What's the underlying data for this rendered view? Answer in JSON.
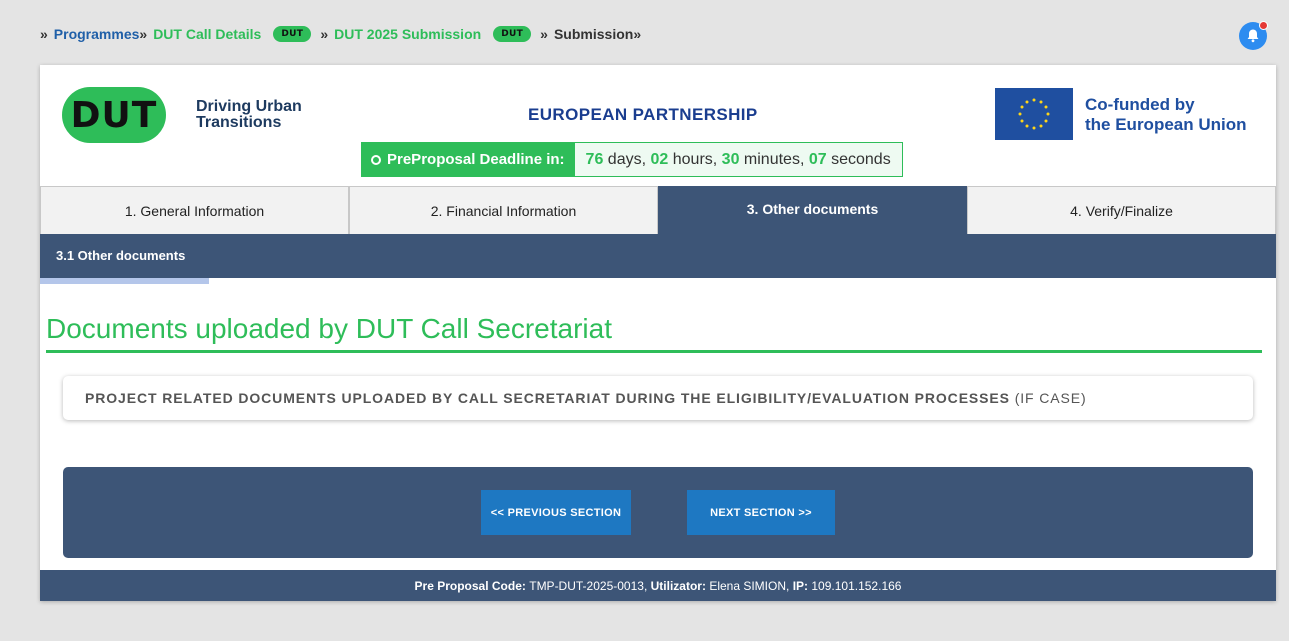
{
  "breadcrumb": {
    "prefix": "»",
    "programmes": "Programmes",
    "sep1": "»",
    "call_details": "DUT Call Details",
    "badge1": "DUT",
    "sep2": "»",
    "submission_2025": "DUT 2025 Submission",
    "badge2": "DUT",
    "sep3": "»",
    "current": "Submission»"
  },
  "header": {
    "logo_text": "DUT",
    "logo_caption_line1": "Driving Urban",
    "logo_caption_line2": "Transitions",
    "partnership": "EUROPEAN PARTNERSHIP",
    "eu_line1": "Co-funded by",
    "eu_line2": "the European Union"
  },
  "deadline": {
    "label": "PreProposal Deadline in:",
    "days": "76",
    "days_unit": "days,",
    "hours": "02",
    "hours_unit": "hours,",
    "minutes": "30",
    "minutes_unit": "minutes,",
    "seconds": "07",
    "seconds_unit": "seconds"
  },
  "tabs": [
    {
      "label": "1. General Information",
      "active": false
    },
    {
      "label": "2. Financial Information",
      "active": false
    },
    {
      "label": "3. Other documents",
      "active": true
    },
    {
      "label": "4. Verify/Finalize",
      "active": false
    }
  ],
  "subnav": {
    "item": "3.1 Other documents"
  },
  "section": {
    "title": "Documents uploaded by DUT Call Secretariat",
    "box_bold": "PROJECT RELATED DOCUMENTS UPLOADED BY CALL SECRETARIAT DURING THE ELIGIBILITY/EVALUATION PROCESSES",
    "box_suffix": "(IF CASE)"
  },
  "navigation": {
    "prev_label": "<< PREVIOUS SECTION",
    "next_label": "NEXT SECTION >>"
  },
  "footer": {
    "code_label": "Pre Proposal Code:",
    "code_value": "TMP-DUT-2025-0013,",
    "user_label": "Utilizator:",
    "user_value": "Elena SIMION,",
    "ip_label": "IP:",
    "ip_value": "109.101.152.166"
  },
  "colors": {
    "green": "#2ebd59",
    "navy": "#3d5577",
    "button_blue": "#1e78c2",
    "eu_blue": "#1f4fa0"
  },
  "icons": [
    "notification-bell-icon",
    "clock-icon",
    "eu-flag-icon"
  ]
}
